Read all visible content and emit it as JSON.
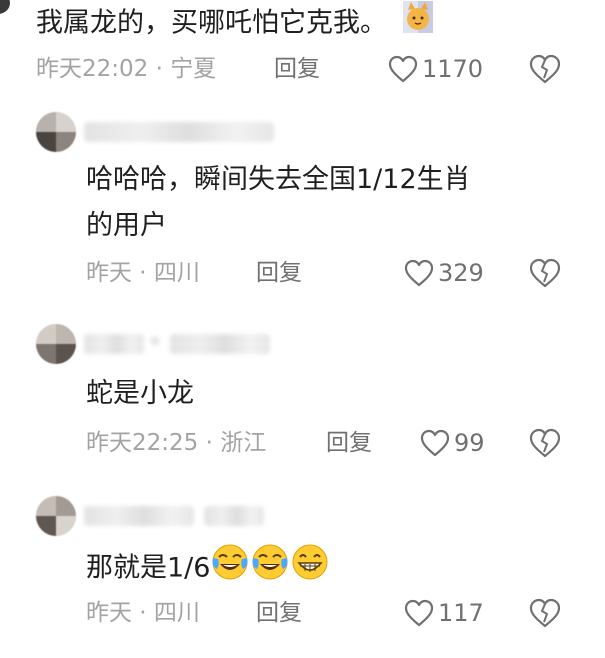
{
  "comments": [
    {
      "text": "我属龙的，买哪吒怕它克我。",
      "meta": "昨天22:02 · 宁夏",
      "reply_label": "回复",
      "likes": "1170"
    },
    {
      "text_line1": "哈哈哈，瞬间失去全国1/12生肖",
      "text_line2": "的用户",
      "meta": "昨天 · 四川",
      "reply_label": "回复",
      "likes": "329"
    },
    {
      "text": "蛇是小龙",
      "meta": "昨天22:25 · 浙江",
      "reply_label": "回复",
      "likes": "99"
    },
    {
      "text": "那就是1/6",
      "meta": "昨天 · 四川",
      "reply_label": "回复",
      "likes": "117"
    }
  ],
  "icons": {
    "like": "heart-outline-icon",
    "dislike": "broken-heart-icon",
    "cat_emoji": "cat-emoji",
    "laughing_emoji": "tears-of-joy-emoji",
    "grin_emoji": "grinning-emoji"
  },
  "colors": {
    "text": "#1f1f1f",
    "meta": "#a3a3a3",
    "action": "#707070"
  }
}
